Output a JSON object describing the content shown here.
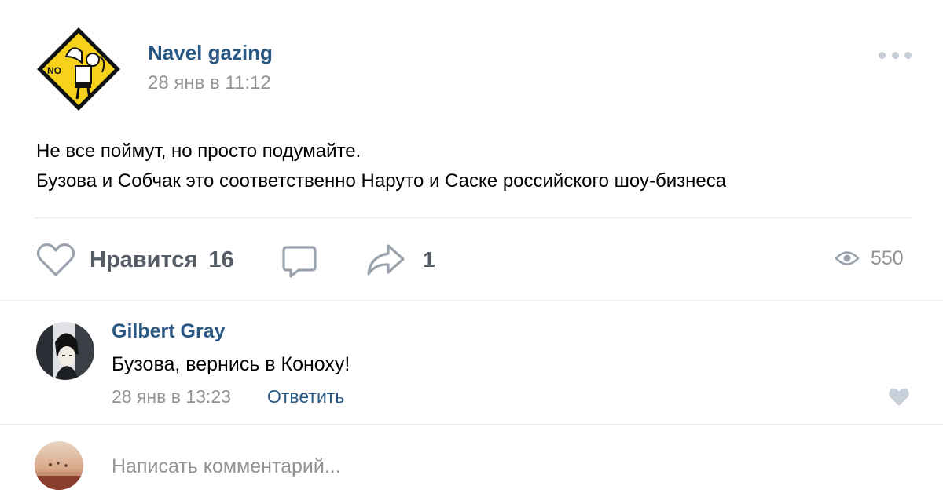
{
  "post": {
    "author": "Navel gazing",
    "date": "28 янв в 11:12",
    "text_line1": "Не все поймут, но просто подумайте.",
    "text_line2": "Бузова и Собчак это соответственно Наруто и Саске российского шоу-бизнеса",
    "avatar_text": "NO"
  },
  "actions": {
    "like_label": "Нравится",
    "like_count": "16",
    "share_count": "1",
    "views_count": "550"
  },
  "comment": {
    "author": "Gilbert Gray",
    "text": "Бузова, вернись в Коноху!",
    "date": "28 янв в 13:23",
    "reply_label": "Ответить"
  },
  "new_comment": {
    "placeholder": "Написать комментарий..."
  },
  "icons": {
    "more": "more-dots-icon",
    "like": "heart-icon",
    "comment": "comment-icon",
    "share": "share-arrow-icon",
    "views": "eye-icon",
    "comment_like": "heart-icon"
  },
  "colors": {
    "link": "#2a5885",
    "secondary": "#939393",
    "action": "#555c66",
    "icon": "#99a2ad",
    "divider": "#e7e8ec",
    "sign_yellow": "#f6d21a"
  }
}
